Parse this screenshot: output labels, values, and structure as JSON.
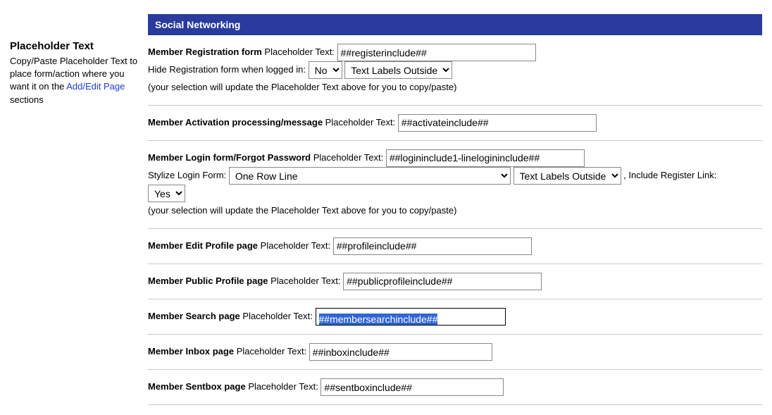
{
  "sidebar": {
    "title": "Placeholder Text",
    "desc_prefix": "Copy/Paste Placeholder Text to place form/action where you want it on the ",
    "link_text": "Add/Edit Page",
    "desc_suffix": " sections"
  },
  "section_title": "Social Networking",
  "rows": {
    "registration": {
      "label_strong": "Member Registration form",
      "label": " Placeholder Text: ",
      "value": "##registerinclude##",
      "hide_label": "Hide Registration form when logged in: ",
      "hide_value": "No",
      "labels_value": "Text Labels Outside",
      "hint": "(your selection will update the Placeholder Text above for you to copy/paste)"
    },
    "activation": {
      "label_strong": "Member Activation processing/message",
      "label": " Placeholder Text: ",
      "value": "##activateinclude##"
    },
    "login": {
      "label_strong": "Member Login form/Forgot Password",
      "label": " Placeholder Text: ",
      "value": "##logininclude1-linelogininclude##",
      "stylize_label": "Stylize Login Form: ",
      "stylize_value": "One Row Line",
      "labels_value": "Text Labels Outside",
      "include_reg_label": " , Include Register Link: ",
      "include_reg_value": "Yes",
      "hint": "(your selection will update the Placeholder Text above for you to copy/paste)"
    },
    "edit_profile": {
      "label_strong": "Member Edit Profile page",
      "label": " Placeholder Text: ",
      "value": "##profileinclude##"
    },
    "public_profile": {
      "label_strong": "Member Public Profile page",
      "label": " Placeholder Text: ",
      "value": "##publicprofileinclude##"
    },
    "search": {
      "label_strong": "Member Search page",
      "label": " Placeholder Text: ",
      "value": "##membersearchinclude##"
    },
    "inbox": {
      "label_strong": "Member Inbox page",
      "label": " Placeholder Text: ",
      "value": "##inboxinclude##"
    },
    "sentbox": {
      "label_strong": "Member Sentbox page",
      "label": " Placeholder Text: ",
      "value": "##sentboxinclude##"
    }
  }
}
